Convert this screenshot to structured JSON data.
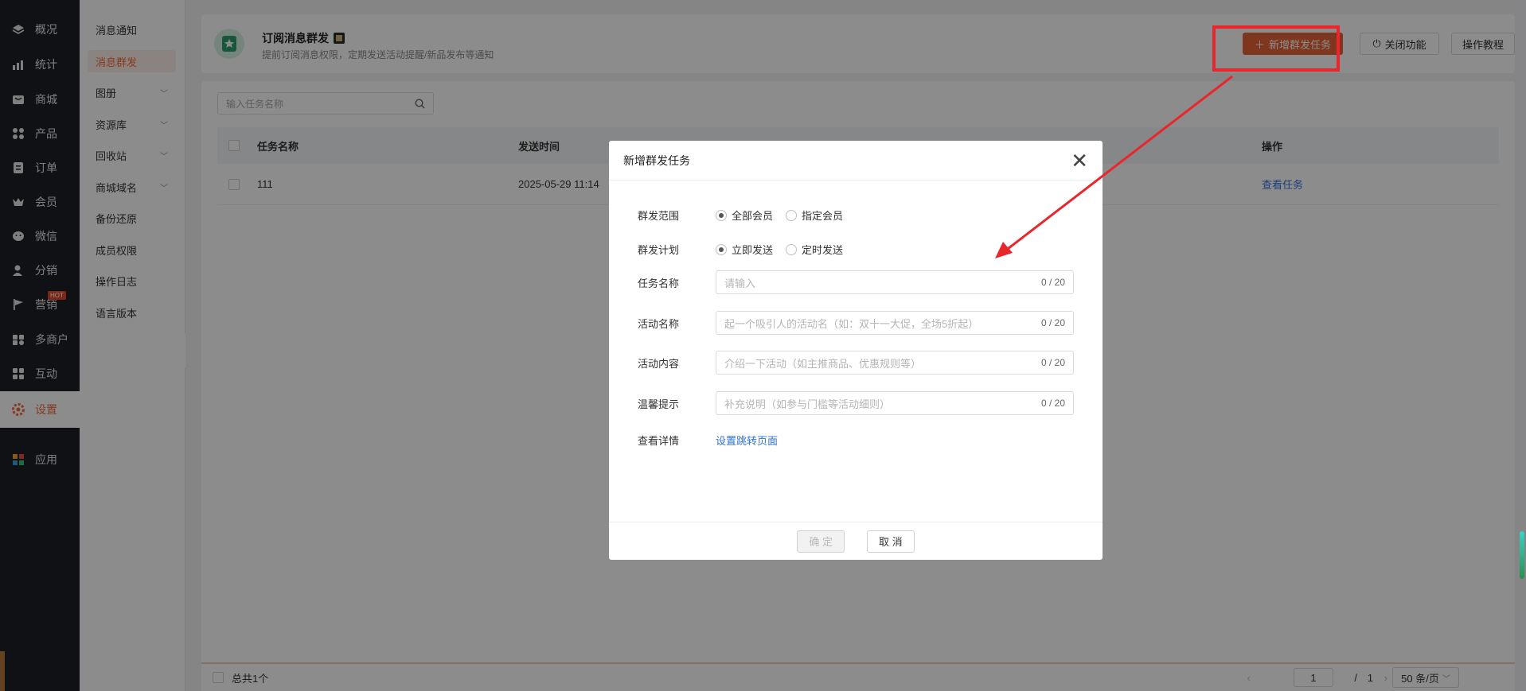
{
  "rail": {
    "items": [
      {
        "label": "概况",
        "icon": "layers-icon"
      },
      {
        "label": "统计",
        "icon": "chart-icon"
      },
      {
        "label": "商城",
        "icon": "store-icon"
      },
      {
        "label": "产品",
        "icon": "grid-icon"
      },
      {
        "label": "订单",
        "icon": "order-icon"
      },
      {
        "label": "会员",
        "icon": "crown-icon"
      },
      {
        "label": "微信",
        "icon": "wechat-icon"
      },
      {
        "label": "分销",
        "icon": "user-share-icon"
      },
      {
        "label": "营销",
        "icon": "flag-icon",
        "badge": "HOT"
      },
      {
        "label": "多商户",
        "icon": "multi-shop-icon"
      },
      {
        "label": "互动",
        "icon": "interact-icon"
      },
      {
        "label": "设置",
        "icon": "gear-icon"
      },
      {
        "label": "应用",
        "icon": "apps-icon"
      }
    ]
  },
  "submenu": {
    "items": [
      {
        "label": "消息通知"
      },
      {
        "label": "消息群发"
      },
      {
        "label": "图册"
      },
      {
        "label": "资源库"
      },
      {
        "label": "回收站"
      },
      {
        "label": "商城域名"
      },
      {
        "label": "备份还原"
      },
      {
        "label": "成员权限"
      },
      {
        "label": "操作日志"
      },
      {
        "label": "语言版本"
      }
    ]
  },
  "header": {
    "title": "订阅消息群发",
    "desc": "提前订阅消息权限，定期发送活动提醒/新品发布等通知",
    "new_task_label": "新增群发任务",
    "close_feature_label": "关闭功能",
    "tutorial_label": "操作教程"
  },
  "search": {
    "placeholder": "输入任务名称"
  },
  "table": {
    "headers": [
      "任务名称",
      "发送时间",
      "",
      "",
      "操作"
    ],
    "rows": [
      {
        "name": "111",
        "time": "2025-05-29 11:14",
        "action": "查看任务"
      }
    ]
  },
  "footer": {
    "total": "总共1个",
    "page": "1",
    "page_sep": "/",
    "page_total": "1",
    "page_size": "50 条/页"
  },
  "modal": {
    "title": "新增群发任务",
    "scope_label": "群发范围",
    "scope_options": [
      "全部会员",
      "指定会员"
    ],
    "plan_label": "群发计划",
    "plan_options": [
      "立即发送",
      "定时发送"
    ],
    "task_name_label": "任务名称",
    "task_name_placeholder": "请输入",
    "activity_name_label": "活动名称",
    "activity_name_placeholder": "起一个吸引人的活动名（如：双十一大促，全场5折起）",
    "activity_content_label": "活动内容",
    "activity_content_placeholder": "介绍一下活动（如主推商品、优惠规则等）",
    "tip_label": "温馨提示",
    "tip_placeholder": "补充说明（如参与门槛等活动细则）",
    "counter": "0 / 20",
    "detail_label": "查看详情",
    "detail_link": "设置跳转页面",
    "confirm_label": "确 定",
    "cancel_label": "取 消"
  },
  "colors": {
    "accent": "#e8633a",
    "annotation": "#e8262c",
    "link": "#2f72d8"
  }
}
